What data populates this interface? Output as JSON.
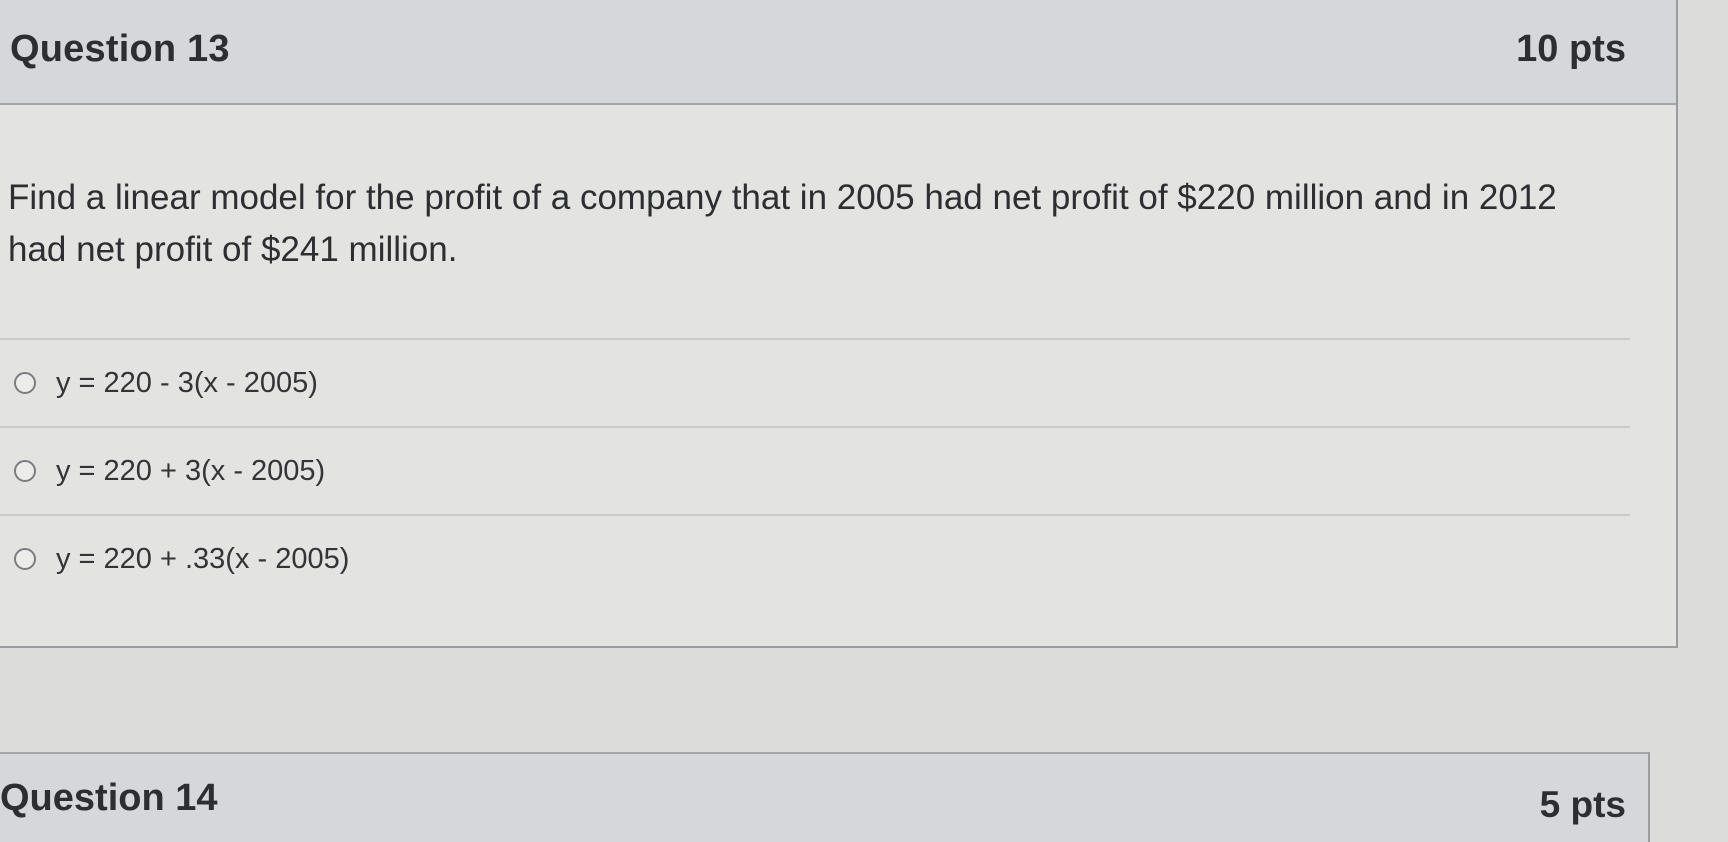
{
  "question13": {
    "title": "Question 13",
    "points": "10 pts",
    "text": "Find a linear model for the profit of a company that in 2005 had net profit of $220 million and in 2012 had net profit of $241 million.",
    "options": [
      "y = 220 - 3(x - 2005)",
      "y = 220 + 3(x - 2005)",
      "y = 220 + .33(x - 2005)"
    ]
  },
  "question14": {
    "title": "Question 14",
    "points": "5 pts"
  }
}
